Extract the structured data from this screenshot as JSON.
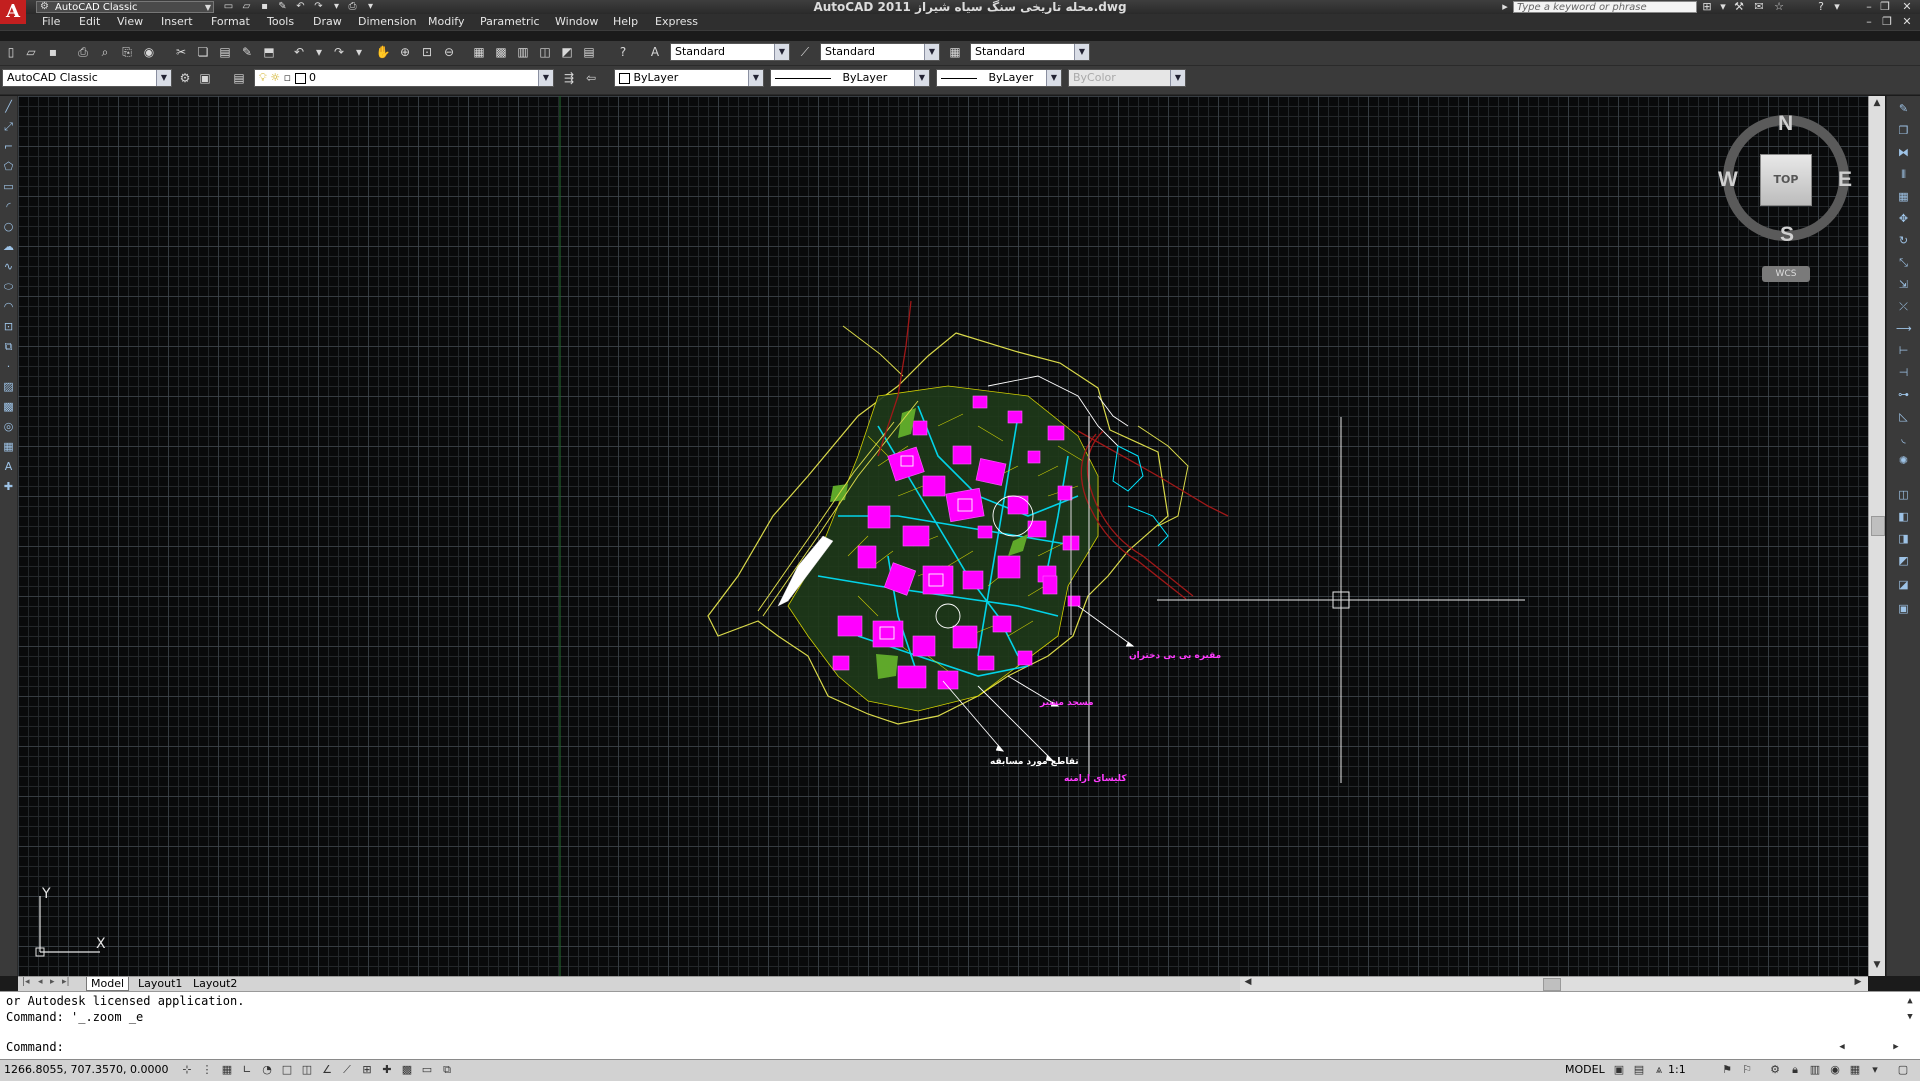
{
  "app": {
    "logo_letter": "A",
    "title": "AutoCAD 2011     محله تاریخی سنگ سیاه شیراز.dwg",
    "workspace": "AutoCAD Classic",
    "search_placeholder": "Type a keyword or phrase"
  },
  "menu": [
    "File",
    "Edit",
    "View",
    "Insert",
    "Format",
    "Tools",
    "Draw",
    "Dimension",
    "Modify",
    "Parametric",
    "Window",
    "Help",
    "Express"
  ],
  "styles_toolbar": {
    "text_style": "Standard",
    "dim_style": "Standard",
    "table_style": "Standard"
  },
  "layers_toolbar": {
    "workspace": "AutoCAD Classic",
    "current_layer": "0"
  },
  "properties_toolbar": {
    "color": "ByLayer",
    "linetype": "ByLayer",
    "lineweight": "ByLayer",
    "plot_style": "ByColor"
  },
  "viewcube": {
    "north": "N",
    "south": "S",
    "east": "E",
    "west": "W",
    "face": "TOP",
    "ucs_menu": "WCS"
  },
  "ucs_icon": {
    "x_label": "X",
    "y_label": "Y"
  },
  "drawing_labels": [
    {
      "id": "label-1",
      "text": "مقبره بی بی دختران",
      "color": "#ff3cff"
    },
    {
      "id": "label-2",
      "text": "مسجد مشیر",
      "color": "#ff3cff"
    },
    {
      "id": "label-3",
      "text": "تقاطع مورد مسابقه",
      "color": "#ffffff"
    },
    {
      "id": "label-4",
      "text": "کلیسای ارامنه",
      "color": "#ff3cff"
    }
  ],
  "layout_tabs": [
    "Model",
    "Layout1",
    "Layout2"
  ],
  "command": {
    "history": [
      "or Autodesk licensed application.",
      "Command: '_.zoom _e"
    ],
    "prompt": "Command:"
  },
  "status": {
    "coordinates": "1266.8055, 707.3570, 0.0000",
    "space": "MODEL",
    "annotation_scale": "1:1"
  },
  "colors": {
    "background": "#090a0b",
    "magenta": "#ff00ff",
    "cyan": "#00e5ff",
    "yellow": "#e6e600",
    "green": "#5fa82a",
    "red_line": "#a01818",
    "white": "#ffffff"
  }
}
